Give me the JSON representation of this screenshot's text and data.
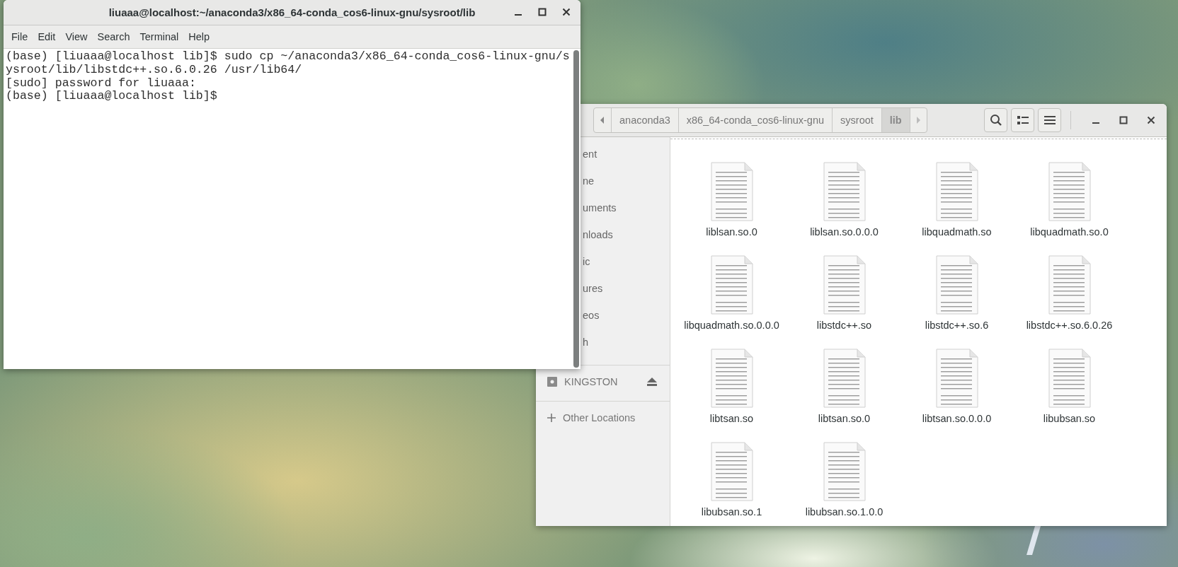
{
  "terminal": {
    "title": "liuaaa@localhost:~/anaconda3/x86_64-conda_cos6-linux-gnu/sysroot/lib",
    "menu": [
      "File",
      "Edit",
      "View",
      "Search",
      "Terminal",
      "Help"
    ],
    "lines": [
      "(base) [liuaaa@localhost lib]$ sudo cp ~/anaconda3/x86_64-conda_cos6-linux-gnu/s",
      "ysroot/lib/libstdc++.so.6.0.26 /usr/lib64/",
      "[sudo] password for liuaaa:",
      "(base) [liuaaa@localhost lib]$"
    ]
  },
  "file_manager": {
    "path": [
      {
        "label": "anaconda3",
        "selected": false
      },
      {
        "label": "x86_64-conda_cos6-linux-gnu",
        "selected": false
      },
      {
        "label": "sysroot",
        "selected": false
      },
      {
        "label": "lib",
        "selected": true
      }
    ],
    "sidebar": {
      "places": [
        "ent",
        "ne",
        "uments",
        "nloads",
        "ic",
        "ures",
        "eos",
        "h"
      ],
      "devices": [
        "KINGSTON"
      ],
      "other": "Other Locations"
    },
    "files": [
      "liblsan.so.0",
      "liblsan.so.0.0.0",
      "libquadmath.so",
      "libquadmath.so.0",
      "libquadmath.so.0.0.0",
      "libstdc++.so",
      "libstdc++.so.6",
      "libstdc++.so.6.0.26",
      "libtsan.so",
      "libtsan.so.0",
      "libtsan.so.0.0.0",
      "libubsan.so",
      "libubsan.so.1",
      "libubsan.so.1.0.0"
    ]
  }
}
